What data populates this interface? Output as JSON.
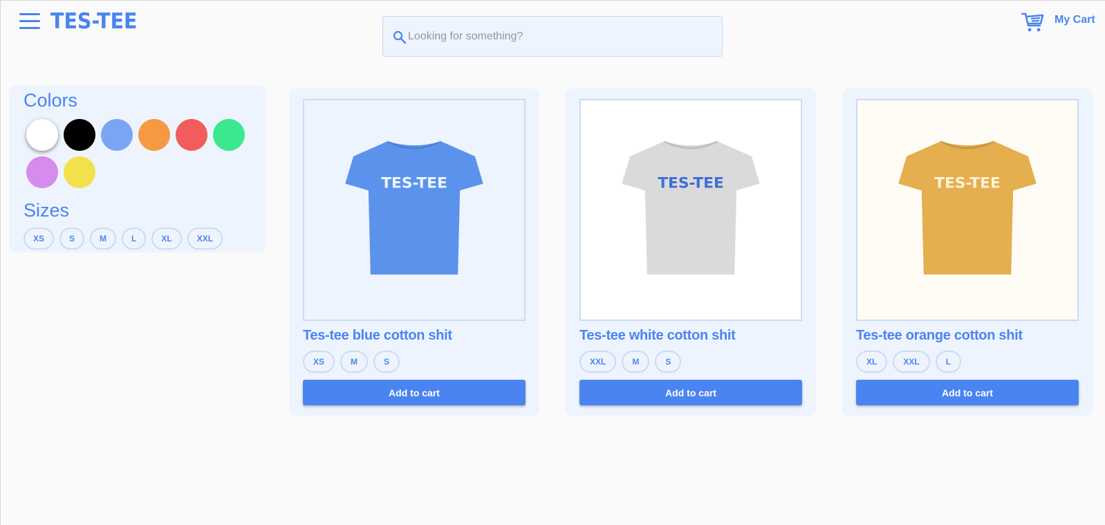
{
  "header": {
    "logo": "TES-TEE",
    "search_placeholder": "Looking for something?",
    "cart_label": "My Cart"
  },
  "filters": {
    "colors_heading": "Colors",
    "colors": [
      {
        "name": "white",
        "hex": "#ffffff",
        "selected": true
      },
      {
        "name": "black",
        "hex": "#000000"
      },
      {
        "name": "blue",
        "hex": "#7aa5f3"
      },
      {
        "name": "orange",
        "hex": "#f59a43"
      },
      {
        "name": "red",
        "hex": "#f25c5c"
      },
      {
        "name": "green",
        "hex": "#3be890"
      },
      {
        "name": "purple",
        "hex": "#d58cec"
      },
      {
        "name": "yellow",
        "hex": "#f2e14c"
      }
    ],
    "sizes_heading": "Sizes",
    "sizes": [
      "XS",
      "S",
      "M",
      "L",
      "XL",
      "XXL"
    ]
  },
  "products": [
    {
      "title": "Tes-tee blue cotton shit",
      "sizes": [
        "XS",
        "M",
        "S"
      ],
      "add_label": "Add to cart",
      "shirt_color": "#5b93ec",
      "print_text": "TES-TEE",
      "print_color": "#eef4ff",
      "photo_bg": "#eef4fd"
    },
    {
      "title": "Tes-tee white cotton shit",
      "sizes": [
        "XXL",
        "M",
        "S"
      ],
      "add_label": "Add to cart",
      "shirt_color": "#dadada",
      "print_text": "TES-TEE",
      "print_color": "#3d6fd6",
      "photo_bg": "#ffffff"
    },
    {
      "title": "Tes-tee orange cotton shit",
      "sizes": [
        "XL",
        "XXL",
        "L"
      ],
      "add_label": "Add to cart",
      "shirt_color": "#e5ae4e",
      "print_text": "TES-TEE",
      "print_color": "#fdf1d6",
      "photo_bg": "#fefcf5"
    }
  ],
  "colors": {
    "accent": "#4a84f0",
    "panel": "#eef4fd"
  }
}
